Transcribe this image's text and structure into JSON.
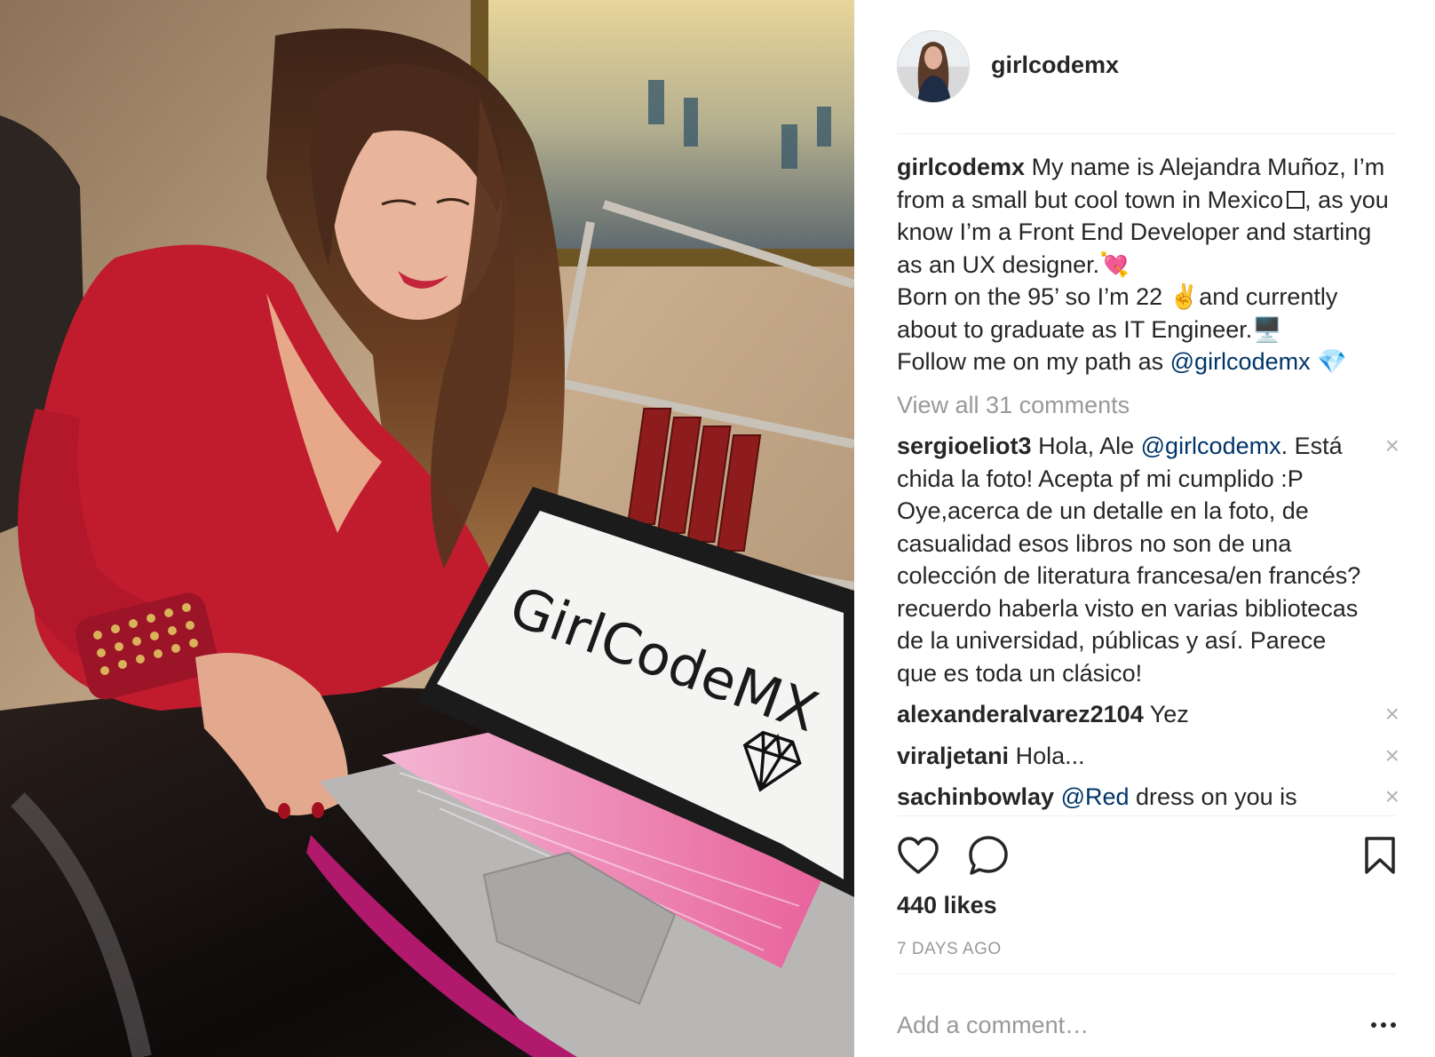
{
  "post": {
    "username": "girlcodemx",
    "image": {
      "screen_text": "GirlCodeMX",
      "alt": "photo"
    },
    "caption": {
      "username": "girlcodemx",
      "text_1": "My name is Alejandra Muñoz, I’m from a small but cool town in Mexico",
      "text_2": ", as you know I’m a Front End Developer and starting as an UX designer.💘\nBorn on the 95’ so I’m 22 ✌️and currently about to graduate as IT Engineer.🖥️\nFollow me on my path as ",
      "mention": "@girlcodemx",
      "text_3": " 💎"
    },
    "view_all_comments": "View all 31 comments",
    "comments": [
      {
        "username": "sergioeliot3",
        "text_before": "Hola, Ale ",
        "mention": "@girlcodemx",
        "text_after": ". Está chida la foto! Acepta pf mi cumplido :P Oye,acerca de un detalle en la foto, de casualidad esos libros no son de una colección de literatura francesa/en francés? recuerdo haberla visto en varias bibliotecas de la universidad, públicas y así. Parece que es toda un clásico!"
      },
      {
        "username": "alexanderalvarez2104",
        "text_before": "Yez",
        "mention": "",
        "text_after": ""
      },
      {
        "username": "viraljetani",
        "text_before": "Hola...",
        "mention": "",
        "text_after": ""
      },
      {
        "username": "sachinbowlay",
        "text_before": "",
        "mention": "@Red",
        "text_after": " dress on you is"
      }
    ],
    "remove_symbol": "×",
    "likes": "440 likes",
    "time_ago": "7 DAYS AGO",
    "add_comment_placeholder": "Add a comment…"
  },
  "icons": {
    "like": "heart-icon",
    "comment": "speech-bubble-icon",
    "save": "bookmark-icon",
    "more": "ellipsis-icon",
    "remove": "close-icon"
  },
  "colors": {
    "text": "#262626",
    "muted": "#999999",
    "mention": "#003569",
    "divider": "#efefef"
  }
}
